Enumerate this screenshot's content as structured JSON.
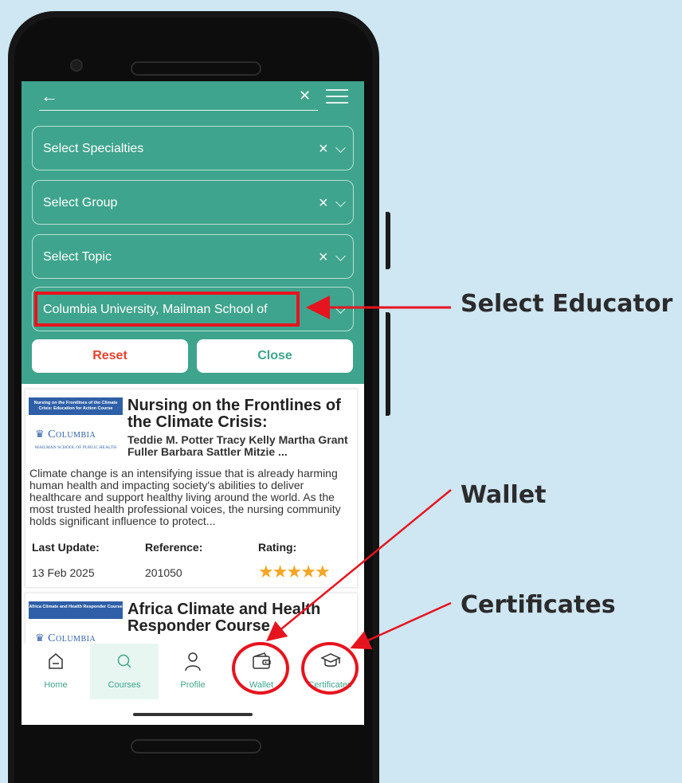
{
  "filters": {
    "specialties": "Select Specialties",
    "group": "Select Group",
    "topic": "Select Topic",
    "educator": "Columbia University, Mailman School of",
    "clear_glyph": "×"
  },
  "buttons": {
    "reset": "Reset",
    "close": "Close"
  },
  "courses": [
    {
      "title": "Nursing on the Frontlines of the Climate Crisis:",
      "authors": "Teddie M. Potter Tracy Kelly Martha Grant Fuller Barbara Sattler Mitzie ...",
      "description": "Climate change is an intensifying issue that is already harming human health and impacting society's abilities to deliver healthcare and support healthy living around the world. As the most trusted health professional voices, the nursing community holds significant influence to protect...",
      "thumb_band": "Nursing on the Frontlines of the Climate Crisis: Education for Action Course",
      "thumb_brand": "Columbia",
      "thumb_school": "Mailman School of Public Health",
      "last_update_label": "Last Update:",
      "last_update": "13 Feb 2025",
      "reference_label": "Reference:",
      "reference": "201050",
      "rating_label": "Rating:",
      "rating": 5
    },
    {
      "title": "Africa Climate and Health Responder Course",
      "thumb_band": "Africa Climate and Health Responder Course",
      "thumb_brand": "Columbia"
    }
  ],
  "nav": [
    {
      "label": "Home",
      "icon": "home-icon"
    },
    {
      "label": "Courses",
      "icon": "search-icon"
    },
    {
      "label": "Profile",
      "icon": "profile-icon"
    },
    {
      "label": "Wallet",
      "icon": "wallet-icon"
    },
    {
      "label": "Certificates",
      "icon": "graduation-cap-icon"
    }
  ],
  "annotations": {
    "select_educator": "Select Educator",
    "wallet": "Wallet",
    "certificates": "Certificates"
  },
  "colors": {
    "header_green": "#3fa48d",
    "reset_red": "#e5412f",
    "annotation_red": "#e6141e",
    "background": "#cfe6f3",
    "star": "#f5a623"
  }
}
